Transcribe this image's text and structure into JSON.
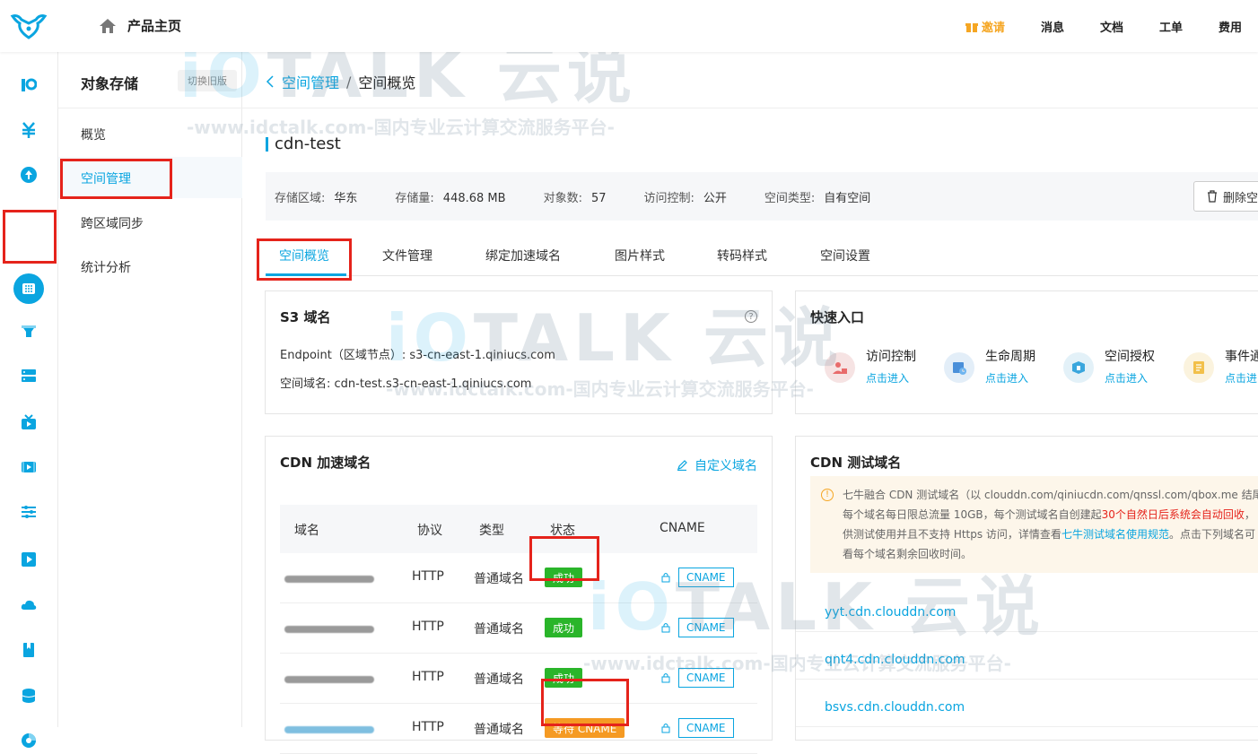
{
  "topbar": {
    "home_label": "产品主页",
    "nav": {
      "invite": "邀请",
      "messages": "消息",
      "docs": "文档",
      "tickets": "工单",
      "billing": "费用"
    }
  },
  "sidemenu": {
    "title": "对象存储",
    "old_version": "切换旧版",
    "items": [
      "概览",
      "空间管理",
      "跨区域同步",
      "统计分析"
    ]
  },
  "breadcrumb": {
    "parent": "空间管理",
    "separator": "/",
    "current": "空间概览"
  },
  "bucket": {
    "name": "cdn-test",
    "info": [
      {
        "label": "存储区域:",
        "value": "华东"
      },
      {
        "label": "存储量:",
        "value": "448.68 MB"
      },
      {
        "label": "对象数:",
        "value": "57"
      },
      {
        "label": "访问控制:",
        "value": "公开"
      },
      {
        "label": "空间类型:",
        "value": "自有空间"
      }
    ],
    "delete_label": "删除空"
  },
  "tabs": [
    "空间概览",
    "文件管理",
    "绑定加速域名",
    "图片样式",
    "转码样式",
    "空间设置"
  ],
  "s3": {
    "title": "S3 域名",
    "endpoint_label": "Endpoint（区域节点）:",
    "endpoint": "s3-cn-east-1.qiniucs.com",
    "domain_label": "空间域名:",
    "domain": "cdn-test.s3-cn-east-1.qiniucs.com"
  },
  "quick": {
    "title": "快速入口",
    "items": [
      {
        "label": "访问控制",
        "action": "点击进入",
        "color": "#f6e3e3"
      },
      {
        "label": "生命周期",
        "action": "点击进入",
        "color": "#e3eef8"
      },
      {
        "label": "空间授权",
        "action": "点击进入",
        "color": "#e3f1f8"
      },
      {
        "label": "事件通",
        "action": "点击进",
        "color": "#fbf3de"
      }
    ]
  },
  "cdn": {
    "title": "CDN 加速域名",
    "custom_label": "自定义域名",
    "headers": [
      "域名",
      "协议",
      "类型",
      "状态",
      "CNAME"
    ],
    "rows": [
      {
        "protocol": "HTTP",
        "type": "普通域名",
        "status": "成功",
        "cname": "CNAME"
      },
      {
        "protocol": "HTTP",
        "type": "普通域名",
        "status": "成功",
        "cname": "CNAME"
      },
      {
        "protocol": "HTTP",
        "type": "普通域名",
        "status": "成功",
        "cname": "CNAME"
      },
      {
        "protocol": "HTTP",
        "type": "普通域名",
        "status": "等待 CNAME",
        "cname": "CNAME"
      }
    ]
  },
  "cdn_test": {
    "title": "CDN 测试域名",
    "notice": {
      "line1": "七牛融合 CDN 测试域名（以 clouddn.com/qiniucdn.com/qnssl.com/qbox.me 结尾)",
      "line2_pre": "每个域名每日限总流量 10GB，每个测试域名自创建起",
      "line2_red": "30个自然日后系统会自动回收",
      "line2_post": "，",
      "line3_pre": "供测试使用并且不支持 Https 访问，详情查看",
      "line3_link": "七牛测试域名使用规范",
      "line3_post": "。点击下列域名可",
      "line4": "看每个域名剩余回收时间。"
    },
    "domains": [
      "yyt.cdn.clouddn.com",
      "qnt4.cdn.clouddn.com",
      "bsvs.cdn.clouddn.com"
    ]
  },
  "watermark": {
    "brand": "TALK",
    "brand_cn": "云说",
    "slogan": "-www.idctalk.com-国内专业云计算交流服务平台-"
  },
  "colors": {
    "accent": "#0aa5e0",
    "success": "#2ab52a",
    "warning": "#f59a23",
    "highlight": "#e5231b"
  }
}
